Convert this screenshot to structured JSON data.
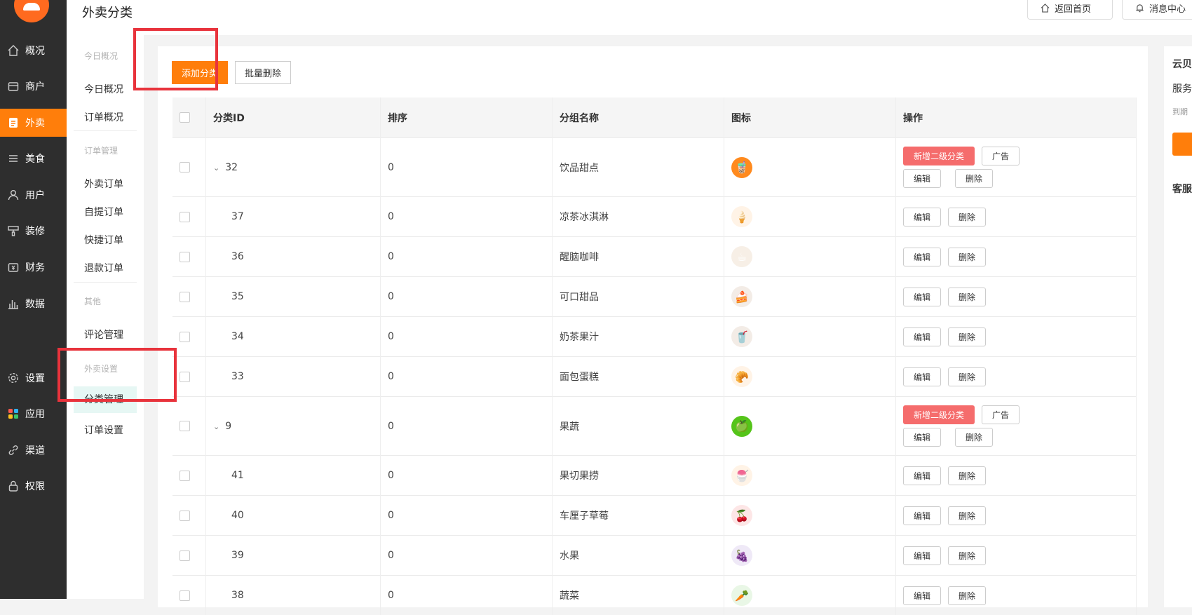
{
  "sidebar": {
    "items": [
      {
        "label": "概况",
        "icon": "home-icon"
      },
      {
        "label": "商户",
        "icon": "store-icon"
      },
      {
        "label": "外卖",
        "icon": "takeout-icon",
        "active": true
      },
      {
        "label": "美食",
        "icon": "list-icon"
      },
      {
        "label": "用户",
        "icon": "user-icon"
      },
      {
        "label": "装修",
        "icon": "brush-icon"
      },
      {
        "label": "财务",
        "icon": "wallet-icon"
      },
      {
        "label": "数据",
        "icon": "bar-chart-icon"
      },
      {
        "label": "设置",
        "icon": "gear-icon"
      },
      {
        "label": "应用",
        "icon": "apps-icon"
      },
      {
        "label": "渠道",
        "icon": "link-icon"
      },
      {
        "label": "权限",
        "icon": "lock-icon"
      }
    ]
  },
  "subnav": {
    "group_today": "今日概况",
    "today": "今日概况",
    "orders_overview": "订单概况",
    "group_orders": "订单管理",
    "takeout_orders": "外卖订单",
    "pickup_orders": "自提订单",
    "quick_orders": "快捷订单",
    "refund_orders": "退款订单",
    "group_other": "其他",
    "reviews": "评论管理",
    "group_settings": "外卖设置",
    "category_mgmt": "分类管理",
    "order_settings": "订单设置"
  },
  "header": {
    "title": "外卖分类",
    "home_btn": "返回首页",
    "msg_btn": "消息中心"
  },
  "toolbar": {
    "add_label": "添加分类",
    "bulk_delete_label": "批量删除"
  },
  "table": {
    "columns": [
      "分类ID",
      "排序",
      "分组名称",
      "图标",
      "操作"
    ],
    "rows": [
      {
        "id": "32",
        "sort": "0",
        "name": "饮品甜点",
        "parent": true,
        "icon": "🧋",
        "icon_bg": "#ff8a1e"
      },
      {
        "id": "37",
        "sort": "0",
        "name": "凉茶冰淇淋",
        "parent": false,
        "icon": "🍦",
        "icon_bg": "#fff3e6"
      },
      {
        "id": "36",
        "sort": "0",
        "name": "醒脑咖啡",
        "parent": false,
        "icon": "☕",
        "icon_bg": "#f7efe6"
      },
      {
        "id": "35",
        "sort": "0",
        "name": "可口甜品",
        "parent": false,
        "icon": "🍰",
        "icon_bg": "#f3ece6"
      },
      {
        "id": "34",
        "sort": "0",
        "name": "奶茶果汁",
        "parent": false,
        "icon": "🥤",
        "icon_bg": "#f3ece6"
      },
      {
        "id": "33",
        "sort": "0",
        "name": "面包蛋糕",
        "parent": false,
        "icon": "🥐",
        "icon_bg": "#fff3e6"
      },
      {
        "id": "9",
        "sort": "0",
        "name": "果蔬",
        "parent": true,
        "icon": "🍏",
        "icon_bg": "#55c41a"
      },
      {
        "id": "41",
        "sort": "0",
        "name": "果切果捞",
        "parent": false,
        "icon": "🍧",
        "icon_bg": "#fff3e6"
      },
      {
        "id": "40",
        "sort": "0",
        "name": "车厘子草莓",
        "parent": false,
        "icon": "🍒",
        "icon_bg": "#fde6e6"
      },
      {
        "id": "39",
        "sort": "0",
        "name": "水果",
        "parent": false,
        "icon": "🍇",
        "icon_bg": "#efe9f7"
      },
      {
        "id": "38",
        "sort": "0",
        "name": "蔬菜",
        "parent": false,
        "icon": "🥕",
        "icon_bg": "#e9f7e6"
      }
    ],
    "actions": {
      "add_sub": "新增二级分类",
      "ad": "广告",
      "edit": "编辑",
      "delete": "删除"
    }
  },
  "right_panel": {
    "line1": "云贝",
    "line2": "服务",
    "line3": "到期",
    "line4": "客服"
  },
  "colors": {
    "accent": "#ff7e0b",
    "danger": "#f56c6c",
    "sidebar_bg": "#2e2e2e",
    "annotation": "#e8333c"
  }
}
